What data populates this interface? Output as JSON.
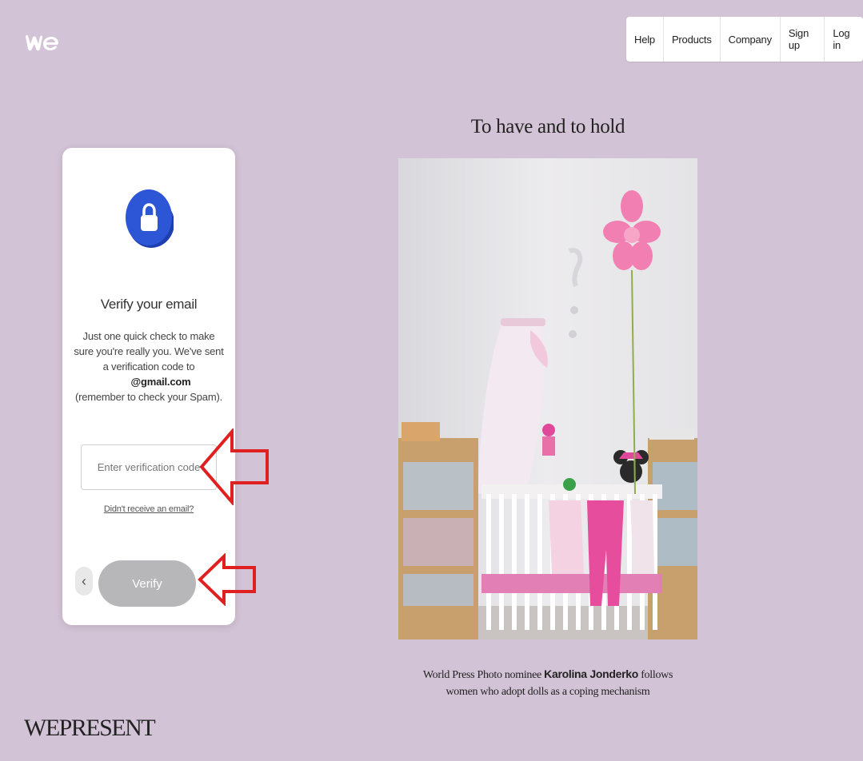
{
  "nav": {
    "items": [
      "Help",
      "Products",
      "Company",
      "Sign up",
      "Log in"
    ]
  },
  "card": {
    "title": "Verify your email",
    "desc_lines": [
      "Just one quick check to make",
      "sure you're really you. We've sent",
      "a verification code to"
    ],
    "email": "@gmail.com",
    "spam_note": "(remember to check your Spam).",
    "input_placeholder": "Enter verification code",
    "resend_link": "Didn't receive an email?",
    "back_symbol": "‹",
    "verify_label": "Verify"
  },
  "article": {
    "title": "To have and to hold",
    "caption_pre": "World Press Photo nominee ",
    "caption_name": "Karolina Jonderko",
    "caption_post": " follows",
    "caption_line2": "women who adopt dolls as a coping mechanism"
  },
  "brand": "WEPRESENT",
  "colors": {
    "background": "#d3c3d6",
    "lock_blue": "#2d56d6",
    "verify_button": "#b7b7b9",
    "annotation_red": "#e02020"
  }
}
